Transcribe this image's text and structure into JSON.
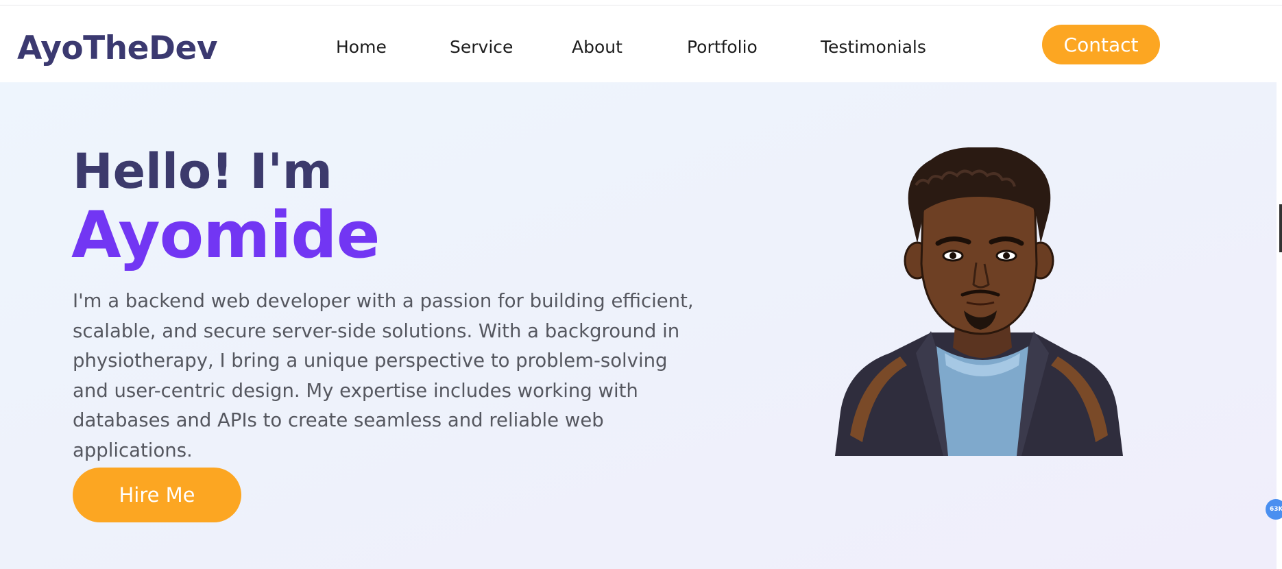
{
  "header": {
    "logo": "AyoTheDev",
    "nav": [
      {
        "label": "Home"
      },
      {
        "label": "Service"
      },
      {
        "label": "About"
      },
      {
        "label": "Portfolio"
      },
      {
        "label": "Testimonials"
      }
    ],
    "contact_label": "Contact"
  },
  "hero": {
    "greeting": "Hello! I'm",
    "name": "Ayomide",
    "bio": "I'm a backend web developer with a passion for building efficient, scalable, and secure server-side solutions. With a background in physiotherapy, I bring a unique perspective to problem-solving and user-centric design. My expertise includes working with databases and APIs to create seamless and reliable web applications.",
    "hire_label": "Hire Me",
    "avatar_icon": "cartoon-avatar"
  },
  "widget": {
    "badge_text": "63K"
  },
  "colors": {
    "accent_orange": "#fca622",
    "brand_purple": "#7236f3",
    "heading_navy": "#3b3970",
    "body_gray": "#55575f"
  }
}
